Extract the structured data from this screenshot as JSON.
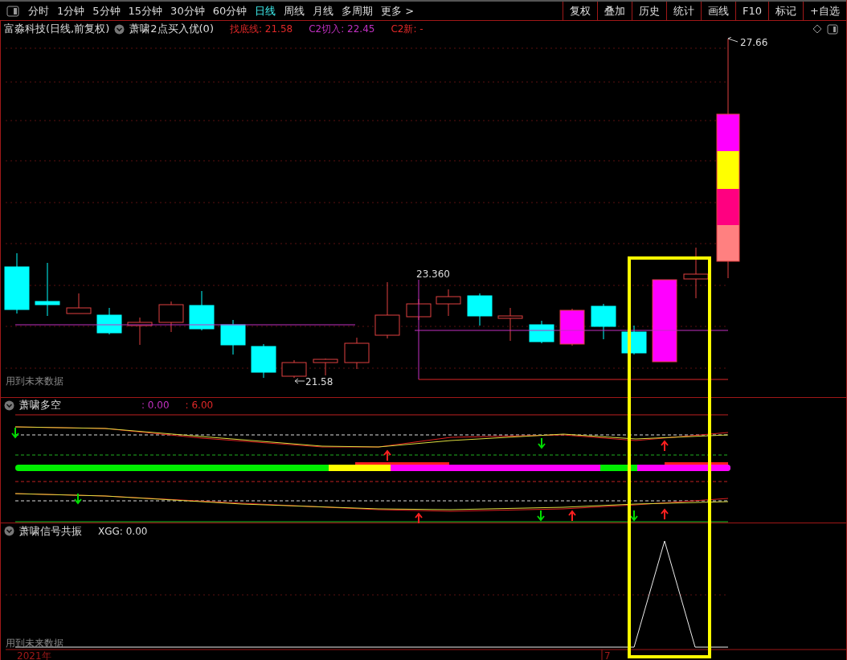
{
  "toolbar": {
    "periods": [
      {
        "label": "分时",
        "selected": false
      },
      {
        "label": "1分钟",
        "selected": false
      },
      {
        "label": "5分钟",
        "selected": false
      },
      {
        "label": "15分钟",
        "selected": false
      },
      {
        "label": "30分钟",
        "selected": false
      },
      {
        "label": "60分钟",
        "selected": false
      },
      {
        "label": "日线",
        "selected": true
      },
      {
        "label": "周线",
        "selected": false
      },
      {
        "label": "月线",
        "selected": false
      },
      {
        "label": "多周期",
        "selected": false
      },
      {
        "label": "更多 >",
        "selected": false
      }
    ],
    "tools": [
      "复权",
      "叠加",
      "历史",
      "统计",
      "画线",
      "F10",
      "标记",
      "+自选"
    ]
  },
  "main_chart": {
    "title": "富淼科技(日线,前复权)",
    "indicator": "萧啸2点买入优(0)",
    "values": [
      {
        "label": "找底线: 21.58",
        "color": "#e02828"
      },
      {
        "label": "C2切入: 22.45",
        "color": "#c030c0"
      },
      {
        "label": "C2新: -",
        "color": "#e02828"
      }
    ],
    "high_label": "27.66",
    "mark_label": "23.360",
    "low_label": "21.58",
    "note": "用到未来数据"
  },
  "indicator_panel": {
    "title": "萧啸多空",
    "values": [
      {
        "label": ": 0.00",
        "color": "#c030c0"
      },
      {
        "label": ": 6.00",
        "color": "#e02828"
      }
    ]
  },
  "signal_panel": {
    "title": "萧啸信号共振",
    "values": [
      {
        "label": "XGG: 0.00",
        "color": "#dddddd"
      }
    ],
    "note": "用到未来数据",
    "date_labels": [
      "2021年",
      "7"
    ]
  }
}
